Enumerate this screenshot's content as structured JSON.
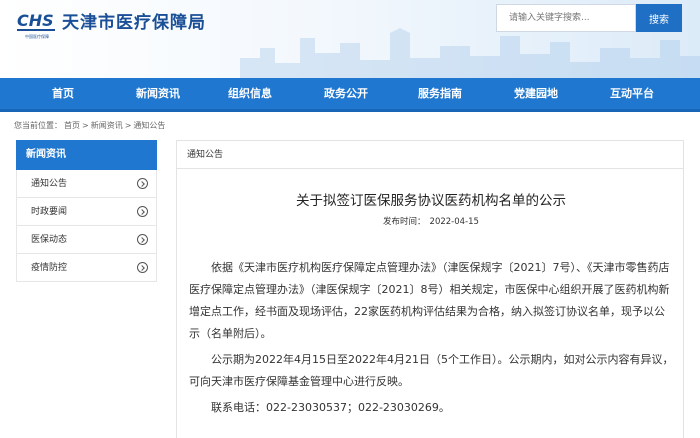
{
  "header": {
    "logo_text": "中国医疗保障",
    "logo_subtext": "CHINA HEALTHCARE SECURITY",
    "site_title": "天津市医疗保障局",
    "search_placeholder": "请输入关键字搜索...",
    "search_button": "搜索",
    "accent_color": "#1f77cf"
  },
  "nav": {
    "items": [
      "首页",
      "新闻资讯",
      "组织信息",
      "政务公开",
      "服务指南",
      "党建园地",
      "互动平台"
    ]
  },
  "breadcrumb": {
    "prefix": "您当前位置：",
    "items": [
      "首页",
      "新闻资讯",
      "通知公告"
    ],
    "separator": ">"
  },
  "sidebar": {
    "title": "新闻资讯",
    "items": [
      "通知公告",
      "时政要闻",
      "医保动态",
      "疫情防控"
    ]
  },
  "main": {
    "tab": "通知公告",
    "title": "关于拟签订医保服务协议医药机构名单的公示",
    "date_label": "发布时间：",
    "date": "2022-04-15",
    "paragraphs": [
      "依据《天津市医疗机构医疗保障定点管理办法》（津医保规字〔2021〕7号）、《天津市零售药店医疗保障定点管理办法》（津医保规字〔2021〕8号）相关规定，市医保中心组织开展了医药机构新增定点工作，经书面及现场评估，22家医药机构评估结果为合格，纳入拟签订协议名单，现予以公示（名单附后）。",
      "公示期为2022年4月15日至2022年4月21日（5个工作日）。公示期内，如对公示内容有异议，可向天津市医疗保障基金管理中心进行反映。",
      "联系电话：022-23030537；022-23030269。"
    ]
  }
}
